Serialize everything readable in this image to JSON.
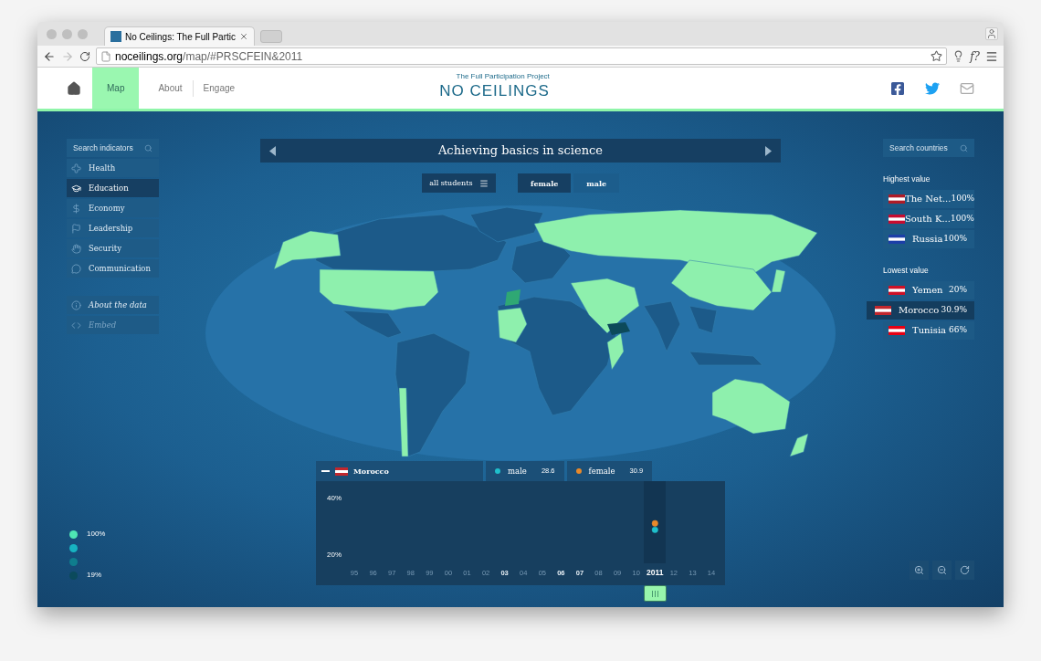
{
  "browser": {
    "tab_title": "No Ceilings: The Full Partic",
    "address": "**noceilings.org**/map/#PRSCFEIN&2011",
    "extension_label": "f?"
  },
  "nav": {
    "items": [
      {
        "label": "Map",
        "selected": true
      },
      {
        "label": "About",
        "selected": false
      },
      {
        "label": "Engage",
        "selected": false
      }
    ]
  },
  "logo": {
    "name": "NO CEILINGS",
    "tagline": "The Full Participation Project"
  },
  "indicator_search": {
    "placeholder": "Search indicators"
  },
  "categories": [
    {
      "label": "Health",
      "kind": "health",
      "selected": false
    },
    {
      "label": "Education",
      "kind": "education",
      "selected": true
    },
    {
      "label": "Economy",
      "kind": "economy",
      "selected": false
    },
    {
      "label": "Leadership",
      "kind": "leadership",
      "selected": false
    },
    {
      "label": "Security",
      "kind": "security",
      "selected": false
    },
    {
      "label": "Communication",
      "kind": "communication",
      "selected": false
    }
  ],
  "data_links": [
    {
      "label": "About the data",
      "kind": "info"
    },
    {
      "label": "Embed",
      "kind": "code"
    }
  ],
  "legend": [
    {
      "label": "100%",
      "color": "#4ee6b4"
    },
    {
      "color": "#17b3c1"
    },
    {
      "color": "#0f7d8d"
    },
    {
      "label": "19%",
      "color": "#0b4a5c"
    }
  ],
  "indicator": {
    "title": "Achieving basics in science"
  },
  "filters": {
    "group": "all students",
    "genders": [
      {
        "label": "female",
        "selected": true
      },
      {
        "label": "male",
        "selected": false
      }
    ]
  },
  "country_search": {
    "placeholder": "Search countries"
  },
  "highest": {
    "heading": "Highest value",
    "countries": [
      {
        "name": "The Net...",
        "value": "100%",
        "selected": false,
        "color": "#ae1c28"
      },
      {
        "name": "South K...",
        "value": "100%",
        "selected": false,
        "color": "#c60c30"
      },
      {
        "name": "Russia",
        "value": "100%",
        "selected": false,
        "color": "#1c3fa8"
      }
    ]
  },
  "lowest": {
    "heading": "Lowest value",
    "countries": [
      {
        "name": "Yemen",
        "value": "20%",
        "selected": false,
        "color": "#ce1126"
      },
      {
        "name": "Morocco",
        "value": "30.9%",
        "selected": true,
        "color": "#c1272d"
      },
      {
        "name": "Tunisia",
        "value": "66%",
        "selected": false,
        "color": "#e70013"
      }
    ]
  },
  "readout": {
    "country": "Morocco",
    "color": "#c1272d",
    "series_values": [
      "28.6",
      "30.9"
    ]
  },
  "timeline": {
    "chart_data": {
      "type": "scatter",
      "x": [
        "95",
        "96",
        "97",
        "98",
        "99",
        "00",
        "01",
        "02",
        "03",
        "04",
        "05",
        "06",
        "07",
        "08",
        "09",
        "10",
        "2011",
        "12",
        "13",
        "14"
      ],
      "ylim": [
        20,
        40
      ],
      "yticks": [
        {
          "value": 20,
          "label": "20%"
        },
        {
          "value": 40,
          "label": "40%"
        }
      ],
      "series": [
        {
          "name": "male",
          "color": "#1fc0cc",
          "values": [
            null,
            null,
            null,
            null,
            null,
            null,
            null,
            null,
            null,
            null,
            null,
            null,
            null,
            null,
            null,
            null,
            28.6,
            null,
            null,
            null
          ]
        },
        {
          "name": "female",
          "color": "#e8892a",
          "values": [
            null,
            null,
            null,
            null,
            null,
            null,
            null,
            null,
            null,
            null,
            null,
            null,
            null,
            null,
            null,
            null,
            30.9,
            null,
            null,
            null
          ]
        }
      ]
    },
    "year_states": [
      {
        "has_data": false,
        "selected": false
      },
      {
        "has_data": false,
        "selected": false
      },
      {
        "has_data": false,
        "selected": false
      },
      {
        "has_data": false,
        "selected": false
      },
      {
        "has_data": false,
        "selected": false
      },
      {
        "has_data": false,
        "selected": false
      },
      {
        "has_data": false,
        "selected": false
      },
      {
        "has_data": false,
        "selected": false
      },
      {
        "has_data": true,
        "selected": false
      },
      {
        "has_data": false,
        "selected": false
      },
      {
        "has_data": false,
        "selected": false
      },
      {
        "has_data": true,
        "selected": false
      },
      {
        "has_data": true,
        "selected": false
      },
      {
        "has_data": false,
        "selected": false
      },
      {
        "has_data": false,
        "selected": false
      },
      {
        "has_data": false,
        "selected": false
      },
      {
        "has_data": true,
        "selected": true
      },
      {
        "has_data": false,
        "selected": false
      },
      {
        "has_data": false,
        "selected": false
      },
      {
        "has_data": false,
        "selected": false
      }
    ]
  }
}
